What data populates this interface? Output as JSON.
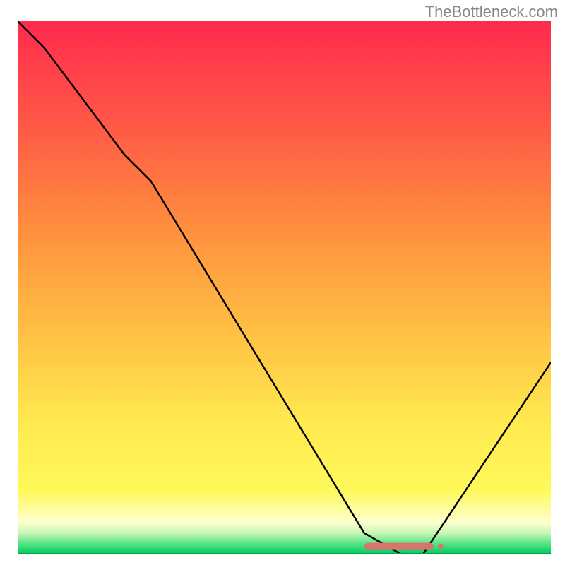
{
  "watermark": "TheBottleneck.com",
  "chart_data": {
    "type": "line",
    "title": "",
    "xlabel": "",
    "ylabel": "",
    "xlim": [
      0,
      100
    ],
    "ylim": [
      0,
      100
    ],
    "line": {
      "name": "bottleneck-curve",
      "x": [
        0,
        5,
        20,
        25,
        65,
        72,
        76,
        100
      ],
      "y": [
        100,
        95,
        75,
        70,
        4,
        0,
        0,
        36
      ]
    },
    "marker_band": {
      "name": "optimal-range",
      "x_start": 65,
      "x_end": 78,
      "y": 1.5,
      "color": "#d9746b"
    },
    "background_gradient": {
      "top": "#ff2a4e",
      "mid1": "#ff7a3d",
      "mid2": "#ffd948",
      "mid3": "#fff95a",
      "mid4": "#fdffcf",
      "bottom_band": "#4fe07a",
      "bottom": "#00c95e"
    }
  }
}
